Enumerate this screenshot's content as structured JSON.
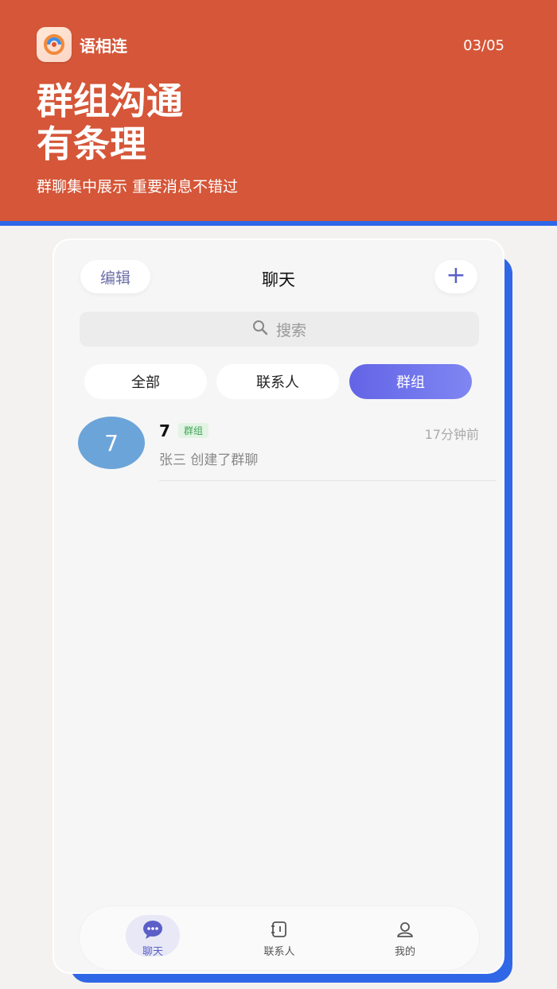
{
  "app": {
    "name": "语相连",
    "page_counter": "03/05"
  },
  "hero": {
    "headline_line1": "群组沟通",
    "headline_line2": "有条理",
    "subtitle": "群聊集中展示 重要消息不错过"
  },
  "header": {
    "edit_label": "编辑",
    "title": "聊天",
    "add_label": "+"
  },
  "search": {
    "placeholder": "搜索"
  },
  "tabs": [
    {
      "label": "全部",
      "active": false
    },
    {
      "label": "联系人",
      "active": false
    },
    {
      "label": "群组",
      "active": true
    }
  ],
  "chats": [
    {
      "avatar_text": "7",
      "name": "7",
      "tag": "群组",
      "time": "17分钟前",
      "preview": "张三 创建了群聊"
    }
  ],
  "bottom_nav": [
    {
      "label": "聊天",
      "icon": "chat-icon",
      "active": true
    },
    {
      "label": "联系人",
      "icon": "contacts-icon",
      "active": false
    },
    {
      "label": "我的",
      "icon": "profile-icon",
      "active": false
    }
  ],
  "colors": {
    "hero_bg": "#d55638",
    "accent_blue": "#2f67e6",
    "active_tab": "#6364e6",
    "avatar": "#6ba4d9"
  }
}
